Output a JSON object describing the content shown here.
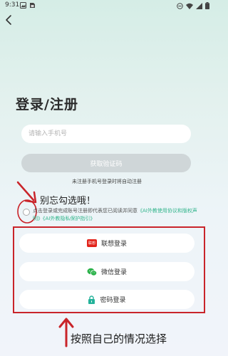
{
  "status_bar": {
    "time": "9:31"
  },
  "title": "登录/注册",
  "phone_input": {
    "placeholder": "请输入手机号"
  },
  "get_code_button": "获取验证码",
  "auto_register_note": "未注册手机号登录时将自动注册",
  "reminder": "别忘勾选哦！",
  "agreement": {
    "prefix": "点击登录或完成账号注册即代表您已阅读并同意",
    "link_user": "《AI外教使用协议和版权声明》",
    "link_privacy": "《AI外教隐私保护指引》"
  },
  "login_options": [
    {
      "label": "联想登录",
      "icon": "lenovo-icon",
      "icon_text": "联想"
    },
    {
      "label": "微信登录",
      "icon": "wechat-icon"
    },
    {
      "label": "密码登录",
      "icon": "lock-icon"
    }
  ],
  "bottom_annotation": "按照自己的情况选择",
  "colors": {
    "accent_green": "#33b58c",
    "annotation_red": "#c9242a",
    "lenovo_red": "#e2231a",
    "wechat_green": "#2bb24a",
    "lock_green": "#24b29a"
  }
}
